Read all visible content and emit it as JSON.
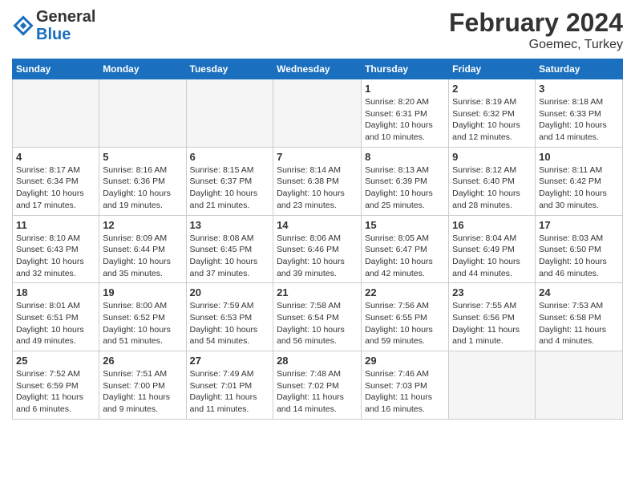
{
  "header": {
    "logo_line1": "General",
    "logo_line2": "Blue",
    "title": "February 2024",
    "subtitle": "Goemec, Turkey"
  },
  "days_of_week": [
    "Sunday",
    "Monday",
    "Tuesday",
    "Wednesday",
    "Thursday",
    "Friday",
    "Saturday"
  ],
  "weeks": [
    [
      {
        "day": "",
        "detail": "",
        "empty": true
      },
      {
        "day": "",
        "detail": "",
        "empty": true
      },
      {
        "day": "",
        "detail": "",
        "empty": true
      },
      {
        "day": "",
        "detail": "",
        "empty": true
      },
      {
        "day": "1",
        "detail": "Sunrise: 8:20 AM\nSunset: 6:31 PM\nDaylight: 10 hours\nand 10 minutes.",
        "empty": false
      },
      {
        "day": "2",
        "detail": "Sunrise: 8:19 AM\nSunset: 6:32 PM\nDaylight: 10 hours\nand 12 minutes.",
        "empty": false
      },
      {
        "day": "3",
        "detail": "Sunrise: 8:18 AM\nSunset: 6:33 PM\nDaylight: 10 hours\nand 14 minutes.",
        "empty": false
      }
    ],
    [
      {
        "day": "4",
        "detail": "Sunrise: 8:17 AM\nSunset: 6:34 PM\nDaylight: 10 hours\nand 17 minutes.",
        "empty": false
      },
      {
        "day": "5",
        "detail": "Sunrise: 8:16 AM\nSunset: 6:36 PM\nDaylight: 10 hours\nand 19 minutes.",
        "empty": false
      },
      {
        "day": "6",
        "detail": "Sunrise: 8:15 AM\nSunset: 6:37 PM\nDaylight: 10 hours\nand 21 minutes.",
        "empty": false
      },
      {
        "day": "7",
        "detail": "Sunrise: 8:14 AM\nSunset: 6:38 PM\nDaylight: 10 hours\nand 23 minutes.",
        "empty": false
      },
      {
        "day": "8",
        "detail": "Sunrise: 8:13 AM\nSunset: 6:39 PM\nDaylight: 10 hours\nand 25 minutes.",
        "empty": false
      },
      {
        "day": "9",
        "detail": "Sunrise: 8:12 AM\nSunset: 6:40 PM\nDaylight: 10 hours\nand 28 minutes.",
        "empty": false
      },
      {
        "day": "10",
        "detail": "Sunrise: 8:11 AM\nSunset: 6:42 PM\nDaylight: 10 hours\nand 30 minutes.",
        "empty": false
      }
    ],
    [
      {
        "day": "11",
        "detail": "Sunrise: 8:10 AM\nSunset: 6:43 PM\nDaylight: 10 hours\nand 32 minutes.",
        "empty": false
      },
      {
        "day": "12",
        "detail": "Sunrise: 8:09 AM\nSunset: 6:44 PM\nDaylight: 10 hours\nand 35 minutes.",
        "empty": false
      },
      {
        "day": "13",
        "detail": "Sunrise: 8:08 AM\nSunset: 6:45 PM\nDaylight: 10 hours\nand 37 minutes.",
        "empty": false
      },
      {
        "day": "14",
        "detail": "Sunrise: 8:06 AM\nSunset: 6:46 PM\nDaylight: 10 hours\nand 39 minutes.",
        "empty": false
      },
      {
        "day": "15",
        "detail": "Sunrise: 8:05 AM\nSunset: 6:47 PM\nDaylight: 10 hours\nand 42 minutes.",
        "empty": false
      },
      {
        "day": "16",
        "detail": "Sunrise: 8:04 AM\nSunset: 6:49 PM\nDaylight: 10 hours\nand 44 minutes.",
        "empty": false
      },
      {
        "day": "17",
        "detail": "Sunrise: 8:03 AM\nSunset: 6:50 PM\nDaylight: 10 hours\nand 46 minutes.",
        "empty": false
      }
    ],
    [
      {
        "day": "18",
        "detail": "Sunrise: 8:01 AM\nSunset: 6:51 PM\nDaylight: 10 hours\nand 49 minutes.",
        "empty": false
      },
      {
        "day": "19",
        "detail": "Sunrise: 8:00 AM\nSunset: 6:52 PM\nDaylight: 10 hours\nand 51 minutes.",
        "empty": false
      },
      {
        "day": "20",
        "detail": "Sunrise: 7:59 AM\nSunset: 6:53 PM\nDaylight: 10 hours\nand 54 minutes.",
        "empty": false
      },
      {
        "day": "21",
        "detail": "Sunrise: 7:58 AM\nSunset: 6:54 PM\nDaylight: 10 hours\nand 56 minutes.",
        "empty": false
      },
      {
        "day": "22",
        "detail": "Sunrise: 7:56 AM\nSunset: 6:55 PM\nDaylight: 10 hours\nand 59 minutes.",
        "empty": false
      },
      {
        "day": "23",
        "detail": "Sunrise: 7:55 AM\nSunset: 6:56 PM\nDaylight: 11 hours\nand 1 minute.",
        "empty": false
      },
      {
        "day": "24",
        "detail": "Sunrise: 7:53 AM\nSunset: 6:58 PM\nDaylight: 11 hours\nand 4 minutes.",
        "empty": false
      }
    ],
    [
      {
        "day": "25",
        "detail": "Sunrise: 7:52 AM\nSunset: 6:59 PM\nDaylight: 11 hours\nand 6 minutes.",
        "empty": false
      },
      {
        "day": "26",
        "detail": "Sunrise: 7:51 AM\nSunset: 7:00 PM\nDaylight: 11 hours\nand 9 minutes.",
        "empty": false
      },
      {
        "day": "27",
        "detail": "Sunrise: 7:49 AM\nSunset: 7:01 PM\nDaylight: 11 hours\nand 11 minutes.",
        "empty": false
      },
      {
        "day": "28",
        "detail": "Sunrise: 7:48 AM\nSunset: 7:02 PM\nDaylight: 11 hours\nand 14 minutes.",
        "empty": false
      },
      {
        "day": "29",
        "detail": "Sunrise: 7:46 AM\nSunset: 7:03 PM\nDaylight: 11 hours\nand 16 minutes.",
        "empty": false
      },
      {
        "day": "",
        "detail": "",
        "empty": true
      },
      {
        "day": "",
        "detail": "",
        "empty": true
      }
    ]
  ]
}
